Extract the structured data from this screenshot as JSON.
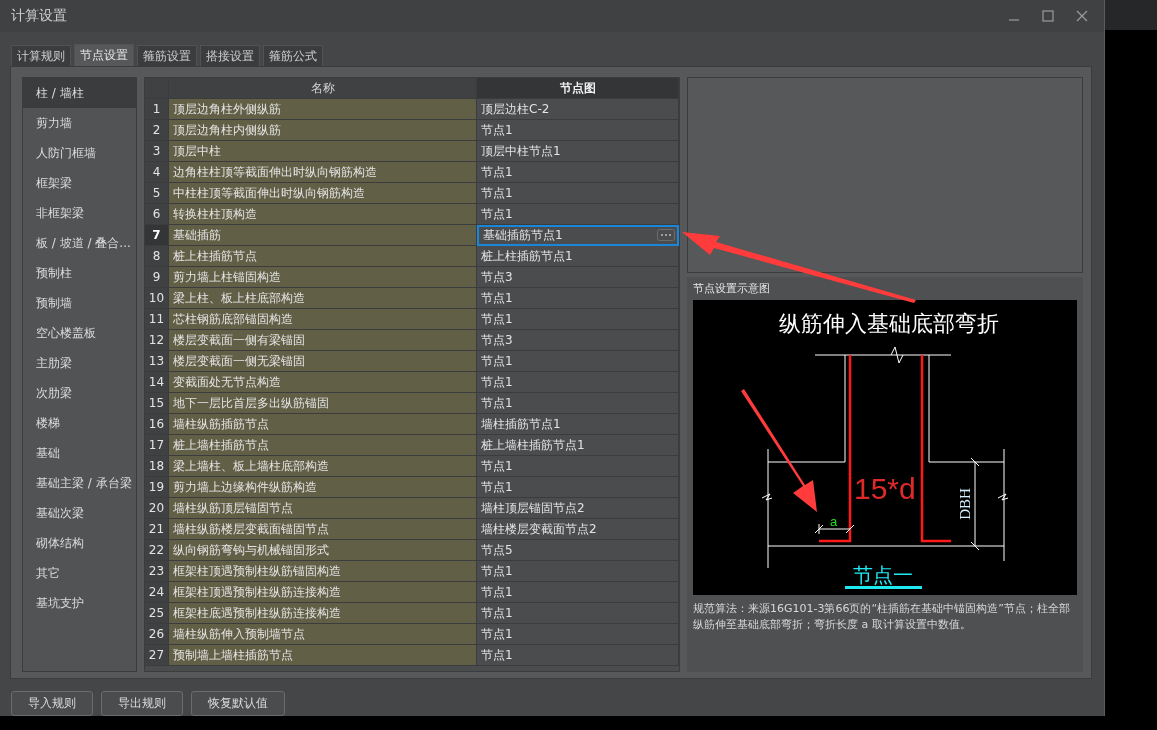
{
  "window": {
    "title": "计算设置"
  },
  "tabs": [
    {
      "label": "计算规则",
      "selected": false
    },
    {
      "label": "节点设置",
      "selected": true
    },
    {
      "label": "箍筋设置",
      "selected": false
    },
    {
      "label": "搭接设置",
      "selected": false
    },
    {
      "label": "箍筋公式",
      "selected": false
    }
  ],
  "sidebar": {
    "items": [
      {
        "label": "柱 / 墙柱",
        "selected": true
      },
      {
        "label": "剪力墙",
        "selected": false
      },
      {
        "label": "人防门框墙",
        "selected": false
      },
      {
        "label": "框架梁",
        "selected": false
      },
      {
        "label": "非框架梁",
        "selected": false
      },
      {
        "label": "板 / 坡道 / 叠合...",
        "selected": false
      },
      {
        "label": "预制柱",
        "selected": false
      },
      {
        "label": "预制墙",
        "selected": false
      },
      {
        "label": "空心楼盖板",
        "selected": false
      },
      {
        "label": "主肋梁",
        "selected": false
      },
      {
        "label": "次肋梁",
        "selected": false
      },
      {
        "label": "楼梯",
        "selected": false
      },
      {
        "label": "基础",
        "selected": false
      },
      {
        "label": "基础主梁 / 承台梁",
        "selected": false
      },
      {
        "label": "基础次梁",
        "selected": false
      },
      {
        "label": "砌体结构",
        "selected": false
      },
      {
        "label": "其它",
        "selected": false
      },
      {
        "label": "基坑支护",
        "selected": false
      }
    ]
  },
  "table": {
    "columns": [
      "名称",
      "节点图"
    ],
    "rows": [
      {
        "number": "1",
        "name": "顶层边角柱外侧纵筋",
        "node": "顶层边柱C-2",
        "selected": false
      },
      {
        "number": "2",
        "name": "顶层边角柱内侧纵筋",
        "node": "节点1",
        "selected": false
      },
      {
        "number": "3",
        "name": "顶层中柱",
        "node": "顶层中柱节点1",
        "selected": false
      },
      {
        "number": "4",
        "name": "边角柱柱顶等截面伸出时纵向钢筋构造",
        "node": "节点1",
        "selected": false
      },
      {
        "number": "5",
        "name": "中柱柱顶等截面伸出时纵向钢筋构造",
        "node": "节点1",
        "selected": false
      },
      {
        "number": "6",
        "name": "转换柱柱顶构造",
        "node": "节点1",
        "selected": false
      },
      {
        "number": "7",
        "name": "基础插筋",
        "node": "基础插筋节点1",
        "selected": true
      },
      {
        "number": "8",
        "name": "桩上柱插筋节点",
        "node": "桩上柱插筋节点1",
        "selected": false
      },
      {
        "number": "9",
        "name": "剪力墙上柱锚固构造",
        "node": "节点3",
        "selected": false
      },
      {
        "number": "10",
        "name": "梁上柱、板上柱底部构造",
        "node": "节点1",
        "selected": false
      },
      {
        "number": "11",
        "name": "芯柱钢筋底部锚固构造",
        "node": "节点1",
        "selected": false
      },
      {
        "number": "12",
        "name": "楼层变截面一侧有梁锚固",
        "node": "节点3",
        "selected": false
      },
      {
        "number": "13",
        "name": "楼层变截面一侧无梁锚固",
        "node": "节点1",
        "selected": false
      },
      {
        "number": "14",
        "name": "变截面处无节点构造",
        "node": "节点1",
        "selected": false
      },
      {
        "number": "15",
        "name": "地下一层比首层多出纵筋锚固",
        "node": "节点1",
        "selected": false
      },
      {
        "number": "16",
        "name": "墙柱纵筋插筋节点",
        "node": "墙柱插筋节点1",
        "selected": false
      },
      {
        "number": "17",
        "name": "桩上墙柱插筋节点",
        "node": "桩上墙柱插筋节点1",
        "selected": false
      },
      {
        "number": "18",
        "name": "梁上墙柱、板上墙柱底部构造",
        "node": "节点1",
        "selected": false
      },
      {
        "number": "19",
        "name": "剪力墙上边缘构件纵筋构造",
        "node": "节点1",
        "selected": false
      },
      {
        "number": "20",
        "name": "墙柱纵筋顶层锚固节点",
        "node": "墙柱顶层锚固节点2",
        "selected": false
      },
      {
        "number": "21",
        "name": "墙柱纵筋楼层变截面锚固节点",
        "node": "墙柱楼层变截面节点2",
        "selected": false
      },
      {
        "number": "22",
        "name": "纵向钢筋弯钩与机械锚固形式",
        "node": "节点5",
        "selected": false
      },
      {
        "number": "23",
        "name": "框架柱顶遇预制柱纵筋锚固构造",
        "node": "节点1",
        "selected": false
      },
      {
        "number": "24",
        "name": "框架柱顶遇预制柱纵筋连接构造",
        "node": "节点1",
        "selected": false
      },
      {
        "number": "25",
        "name": "框架柱底遇预制柱纵筋连接构造",
        "node": "节点1",
        "selected": false
      },
      {
        "number": "26",
        "name": "墙柱纵筋伸入预制墙节点",
        "node": "节点1",
        "selected": false
      },
      {
        "number": "27",
        "name": "预制墙上墙柱插筋节点",
        "node": "节点1",
        "selected": false
      }
    ]
  },
  "diagram": {
    "title": "节点设置示意图",
    "heading": "纵筋伸入基础底部弯折",
    "bend_label": "15*d",
    "a_label": "a",
    "depth_label": "DBH",
    "caption": "节点一",
    "description": "规范算法：来源16G101-3第66页的“柱插筋在基础中锚固构造”节点；柱全部纵筋伸至基础底部弯折；弯折长度 a 取计算设置中数值。"
  },
  "buttons": [
    "导入规则",
    "导出规则",
    "恢复默认值"
  ]
}
